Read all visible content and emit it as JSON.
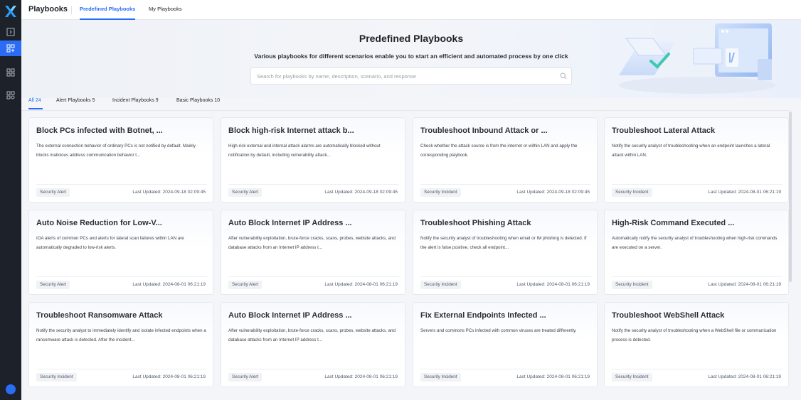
{
  "header": {
    "app_title": "Playbooks",
    "tabs": [
      {
        "label": "Predefined Playbooks",
        "active": true
      },
      {
        "label": "My Playbooks",
        "active": false
      }
    ]
  },
  "rail": {
    "icons": [
      "logo-icon",
      "expand-icon",
      "playbooks-icon",
      "apps-icon",
      "settings-apps-icon",
      "user-icon"
    ],
    "active_item": "playbooks-icon"
  },
  "hero": {
    "title": "Predefined Playbooks",
    "subtitle": "Various playbooks for different scenarios enable you to start an efficient and automated process by one click",
    "search_placeholder": "Search for playbooks by name, description, scenario, and response"
  },
  "filters": [
    {
      "label": "All 24",
      "active": true
    },
    {
      "label": "Alert Playbooks 5",
      "active": false
    },
    {
      "label": "Incident Playbooks 9",
      "active": false
    },
    {
      "label": "Basic Playbooks 10",
      "active": false
    }
  ],
  "cards": [
    {
      "title": "Block PCs infected with Botnet, ...",
      "desc": "The external connection behavior of ordinary PCs is not notified by default. Mainly blocks malicious address communication behavior t...",
      "tag": "Security Alert",
      "updated": "Last Updated: 2024-09-18 02:09:45"
    },
    {
      "title": "Block high-risk Internet attack b...",
      "desc": "High-risk external and internal attack alarms are automatically blocked without notification by default, including vulnerability attack...",
      "tag": "Security Alert",
      "updated": "Last Updated: 2024-09-18 02:09:45"
    },
    {
      "title": "Troubleshoot Inbound Attack or ...",
      "desc": "Check whether the attack source is from the internet or within LAN and apply the corresponding playbook.",
      "tag": "Security Incident",
      "updated": "Last Updated: 2024-09-18 02:09:45"
    },
    {
      "title": "Troubleshoot Lateral Attack",
      "desc": "Notify the security analyst of troubleshooting when an endpoint launches a lateral attack within LAN.",
      "tag": "Security Incident",
      "updated": "Last Updated: 2024-08-01 06:21:19"
    },
    {
      "title": "Auto Noise Reduction for Low-V...",
      "desc": "IOA alerts of common PCs and alerts for lateral scan failures within LAN are automatically degraded to low-risk alerts.",
      "tag": "Security Alert",
      "updated": "Last Updated: 2024-08-01 06:21:19"
    },
    {
      "title": "Auto Block Internet IP Address ...",
      "desc": "After vulnerability exploitation, brute-force cracks, scans, probes, website attacks, and database attacks from an Internet IP address t...",
      "tag": "Security Alert",
      "updated": "Last Updated: 2024-08-01 06:21:19"
    },
    {
      "title": "Troubleshoot Phishing Attack",
      "desc": "Notify the security analyst of troubleshooting when email or IM phishing is detected. If the alert is false positive, check all endpoint...",
      "tag": "Security Incident",
      "updated": "Last Updated: 2024-08-01 06:21:19"
    },
    {
      "title": "High-Risk Command Executed ...",
      "desc": "Automatically notify the security analyst of troubleshooting when high-risk commands are executed on a server.",
      "tag": "Security Incident",
      "updated": "Last Updated: 2024-08-01 06:21:19"
    },
    {
      "title": "Troubleshoot Ransomware Attack",
      "desc": "Notify the security analyst to immediately identify and isolate infected endpoints when a ransomware attack is detected. After the incident...",
      "tag": "Security Incident",
      "updated": "Last Updated: 2024-08-01 06:21:19"
    },
    {
      "title": "Auto Block Internet IP Address ...",
      "desc": "After vulnerability exploitation, brute-force cracks, scans, probes, website attacks, and database attacks from an Internet IP address t...",
      "tag": "Security Alert",
      "updated": "Last Updated: 2024-08-01 06:21:19"
    },
    {
      "title": "Fix External Endpoints Infected ...",
      "desc": "Servers and commons PCs infected with common viruses are treated differently.",
      "tag": "Security Incident",
      "updated": "Last Updated: 2024-08-01 06:21:19"
    },
    {
      "title": "Troubleshoot WebShell Attack",
      "desc": "Notify the security analyst of troubleshooting when a WebShell file or communication process is detected.",
      "tag": "Security Incident",
      "updated": "Last Updated: 2024-08-01 06:21:19"
    }
  ],
  "colors": {
    "accent": "#2a6df4",
    "rail_bg": "#1d2129",
    "tag_bg": "#f0f2f5"
  }
}
